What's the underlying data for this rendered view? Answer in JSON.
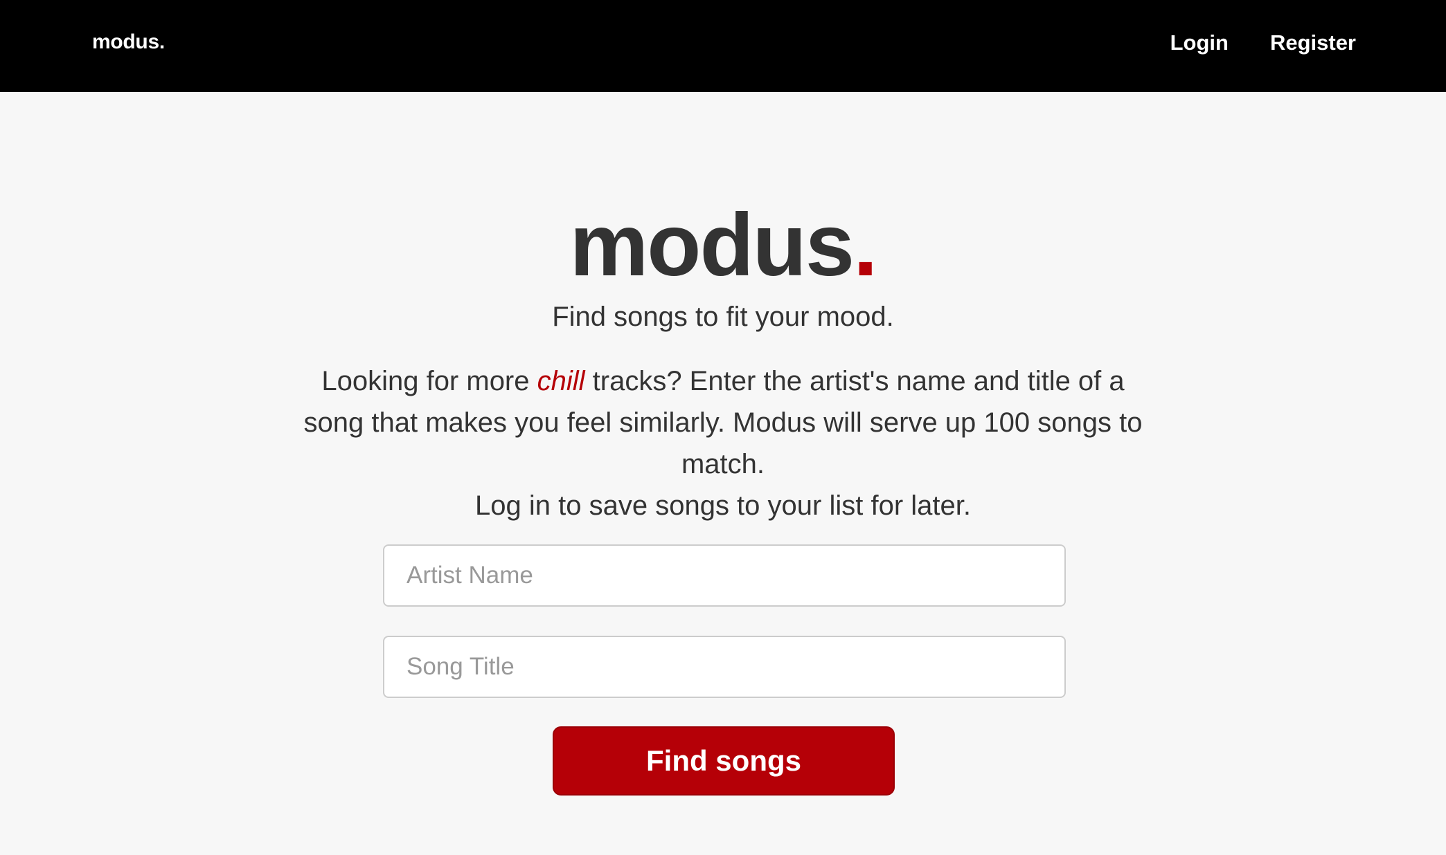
{
  "navbar": {
    "brand": "modus.",
    "links": [
      "Login",
      "Register"
    ]
  },
  "hero": {
    "title_text": "modus",
    "title_dot": ".",
    "tagline": "Find songs to fit your mood.",
    "description": {
      "part1": "Looking for more ",
      "emphasis": "chill",
      "part2": " tracks? Enter the artist's name and title of a song that makes you feel similarly. Modus will serve up 100 songs to match.",
      "line2": "Log in to save songs to your list for later."
    }
  },
  "form": {
    "artist_placeholder": "Artist Name",
    "song_placeholder": "Song Title",
    "submit_label": "Find songs"
  },
  "colors": {
    "accent": "#b50007",
    "navbar": "#000000",
    "background": "#f7f7f7",
    "text": "#333333"
  }
}
